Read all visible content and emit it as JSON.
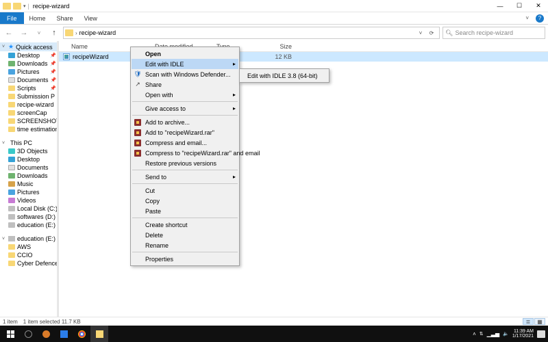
{
  "window": {
    "title": "recipe-wizard"
  },
  "ribbon": {
    "file": "File",
    "tabs": [
      "Home",
      "Share",
      "View"
    ]
  },
  "breadcrumb": {
    "current": "recipe-wizard"
  },
  "search": {
    "placeholder": "Search recipe-wizard"
  },
  "columns": {
    "name": "Name",
    "date": "Date modified",
    "type": "Type",
    "size": "Size"
  },
  "sidebar": {
    "quick_access": {
      "label": "Quick access"
    },
    "quick_items": [
      {
        "label": "Desktop",
        "icon": "desktop",
        "pin": true
      },
      {
        "label": "Downloads",
        "icon": "down",
        "pin": true
      },
      {
        "label": "Pictures",
        "icon": "pic",
        "pin": true
      },
      {
        "label": "Documents",
        "icon": "doc",
        "pin": true
      },
      {
        "label": "Scripts",
        "icon": "folder",
        "pin": true
      },
      {
        "label": "Submission P",
        "icon": "folder",
        "pin": true
      },
      {
        "label": "recipe-wizard",
        "icon": "folder",
        "pin": false
      },
      {
        "label": "screenCap",
        "icon": "folder",
        "pin": false
      },
      {
        "label": "SCREENSHOTS",
        "icon": "folder",
        "pin": false
      },
      {
        "label": "time estimation",
        "icon": "folder",
        "pin": false
      }
    ],
    "this_pc": {
      "label": "This PC"
    },
    "pc_items": [
      {
        "label": "3D Objects",
        "icon": "3d"
      },
      {
        "label": "Desktop",
        "icon": "desktop"
      },
      {
        "label": "Documents",
        "icon": "doc"
      },
      {
        "label": "Downloads",
        "icon": "down"
      },
      {
        "label": "Music",
        "icon": "music"
      },
      {
        "label": "Pictures",
        "icon": "pic"
      },
      {
        "label": "Videos",
        "icon": "video"
      },
      {
        "label": "Local Disk (C:)",
        "icon": "drive"
      },
      {
        "label": "softwares (D:)",
        "icon": "drive"
      },
      {
        "label": "education (E:)",
        "icon": "drive"
      }
    ],
    "edu": {
      "label": "education (E:)"
    },
    "edu_items": [
      {
        "label": "AWS",
        "icon": "folder"
      },
      {
        "label": "CCIO",
        "icon": "folder"
      },
      {
        "label": "Cyber Defence",
        "icon": "folder"
      }
    ]
  },
  "files": [
    {
      "name": "recipeWizard",
      "date": "",
      "type": "",
      "size": "12 KB"
    }
  ],
  "status": {
    "items": "1 item",
    "selected": "1 item selected  11.7 KB"
  },
  "context_menu": {
    "open": "Open",
    "edit_idle": "Edit with IDLE",
    "scan": "Scan with Windows Defender...",
    "share": "Share",
    "open_with": "Open with",
    "give_access": "Give access to",
    "add_archive": "Add to archive...",
    "add_rar": "Add to \"recipeWizard.rar\"",
    "compress_email": "Compress and email...",
    "compress_rar_email": "Compress to \"recipeWizard.rar\" and email",
    "restore": "Restore previous versions",
    "send_to": "Send to",
    "cut": "Cut",
    "copy": "Copy",
    "paste": "Paste",
    "shortcut": "Create shortcut",
    "delete": "Delete",
    "rename": "Rename",
    "properties": "Properties"
  },
  "submenu": {
    "idle38": "Edit with IDLE 3.8 (64-bit)"
  },
  "tray": {
    "time": "11:39 AM",
    "date": "1/17/2021"
  }
}
